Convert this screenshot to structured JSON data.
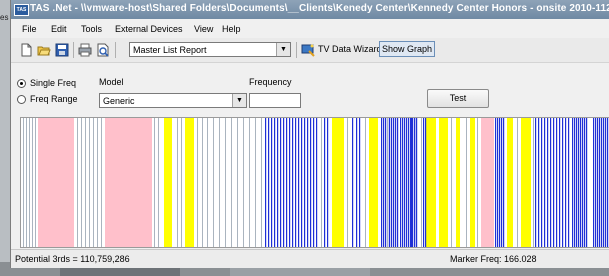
{
  "window": {
    "title": "TAS .Net - \\\\vmware-host\\Shared Folders\\Documents\\__Clients\\Kenedy Center\\Kennedy Center Honors - onsite 2010-112",
    "app_icon_label": "TAS",
    "desktop_edge_text": "es"
  },
  "menu": {
    "items": [
      "File",
      "Edit",
      "Tools",
      "External Devices",
      "View",
      "Help"
    ]
  },
  "toolbar": {
    "report_select": "Master List Report",
    "tv_wizard_label": "TV Data Wizard",
    "show_graph_label": "Show Graph",
    "icons": [
      "new-file-icon",
      "open-folder-icon",
      "save-icon",
      "print-icon",
      "print-preview-icon",
      "tv-wizard-icon"
    ]
  },
  "controls": {
    "single_freq_label": "Single Freq",
    "freq_range_label": "Freq Range",
    "selected_mode": "Single Freq",
    "model_label": "Model",
    "model_value": "Generic",
    "frequency_label": "Frequency",
    "frequency_value": "",
    "test_label": "Test"
  },
  "graph": {
    "colors": {
      "blue": "#1f2fd6",
      "yellow": "#ffff00",
      "pink": "#ffc0cb",
      "gray": "#aab4bf",
      "background": "#ffffff"
    }
  },
  "status": {
    "potential": "Potential 3rds = 110,759,286",
    "marker": "Marker Freq: 166.028"
  }
}
